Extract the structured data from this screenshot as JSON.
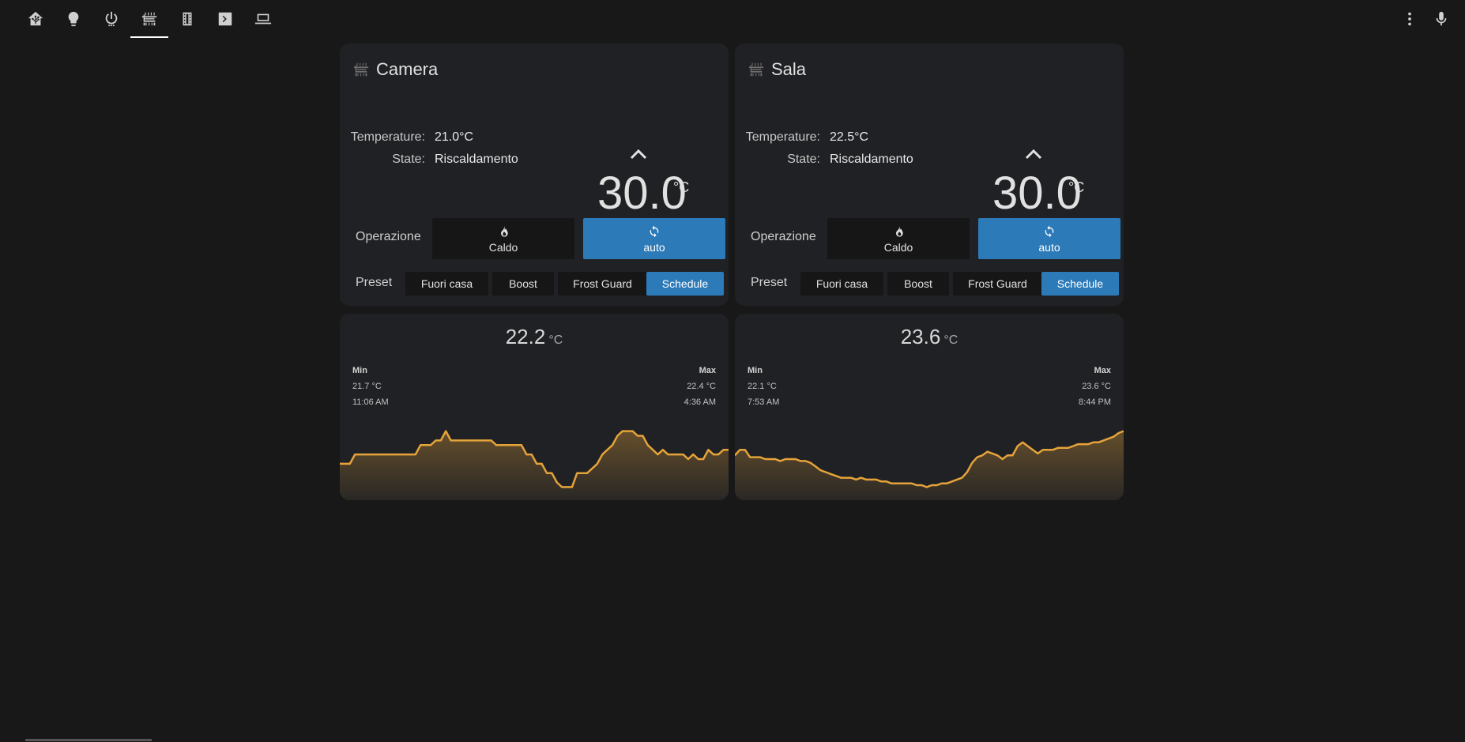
{
  "nav": {
    "tabs": [
      {
        "icon": "home-assistant-icon"
      },
      {
        "icon": "lightbulb-icon"
      },
      {
        "icon": "power-icon"
      },
      {
        "icon": "radiator-icon",
        "active": true
      },
      {
        "icon": "film-icon"
      },
      {
        "icon": "terminal-icon"
      },
      {
        "icon": "laptop-icon"
      }
    ],
    "right": [
      {
        "icon": "more-vertical-icon"
      },
      {
        "icon": "microphone-icon"
      }
    ]
  },
  "thermostats": [
    {
      "name": "Camera",
      "temperature_label": "Temperature:",
      "temperature_value": "21.0°C",
      "state_label": "State:",
      "state_value": "Riscaldamento",
      "setpoint": "30.0",
      "setpoint_unit": "°C",
      "operation_label": "Operazione",
      "operations": [
        {
          "label": "Caldo",
          "icon": "flame-icon",
          "active": false
        },
        {
          "label": "auto",
          "icon": "refresh-icon",
          "active": true
        }
      ],
      "preset_label": "Preset",
      "presets": [
        {
          "label": "Fuori casa",
          "active": false
        },
        {
          "label": "Boost",
          "active": false
        },
        {
          "label": "Frost Guard",
          "active": false
        },
        {
          "label": "Schedule",
          "active": true
        }
      ]
    },
    {
      "name": "Sala",
      "temperature_label": "Temperature:",
      "temperature_value": "22.5°C",
      "state_label": "State:",
      "state_value": "Riscaldamento",
      "setpoint": "30.0",
      "setpoint_unit": "°C",
      "operation_label": "Operazione",
      "operations": [
        {
          "label": "Caldo",
          "icon": "flame-icon",
          "active": false
        },
        {
          "label": "auto",
          "icon": "refresh-icon",
          "active": true
        }
      ],
      "preset_label": "Preset",
      "presets": [
        {
          "label": "Fuori casa",
          "active": false
        },
        {
          "label": "Boost",
          "active": false
        },
        {
          "label": "Frost Guard",
          "active": false
        },
        {
          "label": "Schedule",
          "active": true
        }
      ]
    }
  ],
  "sensors": [
    {
      "value": "22.2",
      "unit": "°C",
      "min_label": "Min",
      "min_value": "21.7 °C",
      "min_time": "11:06 AM",
      "max_label": "Max",
      "max_value": "22.4 °C",
      "max_time": "4:36 AM",
      "line_color": "#e5a33a",
      "history": [
        21.95,
        21.95,
        21.95,
        22.05,
        22.05,
        22.05,
        22.05,
        22.05,
        22.05,
        22.05,
        22.05,
        22.05,
        22.05,
        22.05,
        22.05,
        22.05,
        22.15,
        22.15,
        22.15,
        22.2,
        22.2,
        22.3,
        22.2,
        22.2,
        22.2,
        22.2,
        22.2,
        22.2,
        22.2,
        22.2,
        22.2,
        22.15,
        22.15,
        22.15,
        22.15,
        22.15,
        22.15,
        22.05,
        22.05,
        21.95,
        21.95,
        21.85,
        21.85,
        21.75,
        21.7,
        21.7,
        21.7,
        21.85,
        21.85,
        21.85,
        21.9,
        21.95,
        22.05,
        22.1,
        22.15,
        22.25,
        22.3,
        22.3,
        22.3,
        22.25,
        22.25,
        22.15,
        22.1,
        22.05,
        22.1,
        22.05,
        22.05,
        22.05,
        22.05,
        22.0,
        22.05,
        22.0,
        22.0,
        22.1,
        22.05,
        22.05,
        22.1,
        22.1
      ]
    },
    {
      "value": "23.6",
      "unit": "°C",
      "min_label": "Min",
      "min_value": "22.1 °C",
      "min_time": "7:53 AM",
      "max_label": "Max",
      "max_value": "23.6 °C",
      "max_time": "8:44 PM",
      "line_color": "#e5a33a",
      "history": [
        22.95,
        23.1,
        23.1,
        22.9,
        22.9,
        22.9,
        22.85,
        22.85,
        22.85,
        22.8,
        22.85,
        22.85,
        22.85,
        22.8,
        22.8,
        22.75,
        22.65,
        22.55,
        22.5,
        22.45,
        22.4,
        22.35,
        22.35,
        22.35,
        22.3,
        22.35,
        22.3,
        22.3,
        22.3,
        22.25,
        22.25,
        22.2,
        22.2,
        22.2,
        22.2,
        22.2,
        22.15,
        22.15,
        22.1,
        22.15,
        22.15,
        22.2,
        22.2,
        22.25,
        22.3,
        22.35,
        22.5,
        22.75,
        22.9,
        22.95,
        23.05,
        23.0,
        22.95,
        22.85,
        22.95,
        22.95,
        23.2,
        23.3,
        23.2,
        23.1,
        23.0,
        23.1,
        23.1,
        23.1,
        23.15,
        23.15,
        23.15,
        23.2,
        23.25,
        23.25,
        23.25,
        23.3,
        23.3,
        23.35,
        23.4,
        23.45,
        23.55,
        23.6
      ]
    }
  ]
}
